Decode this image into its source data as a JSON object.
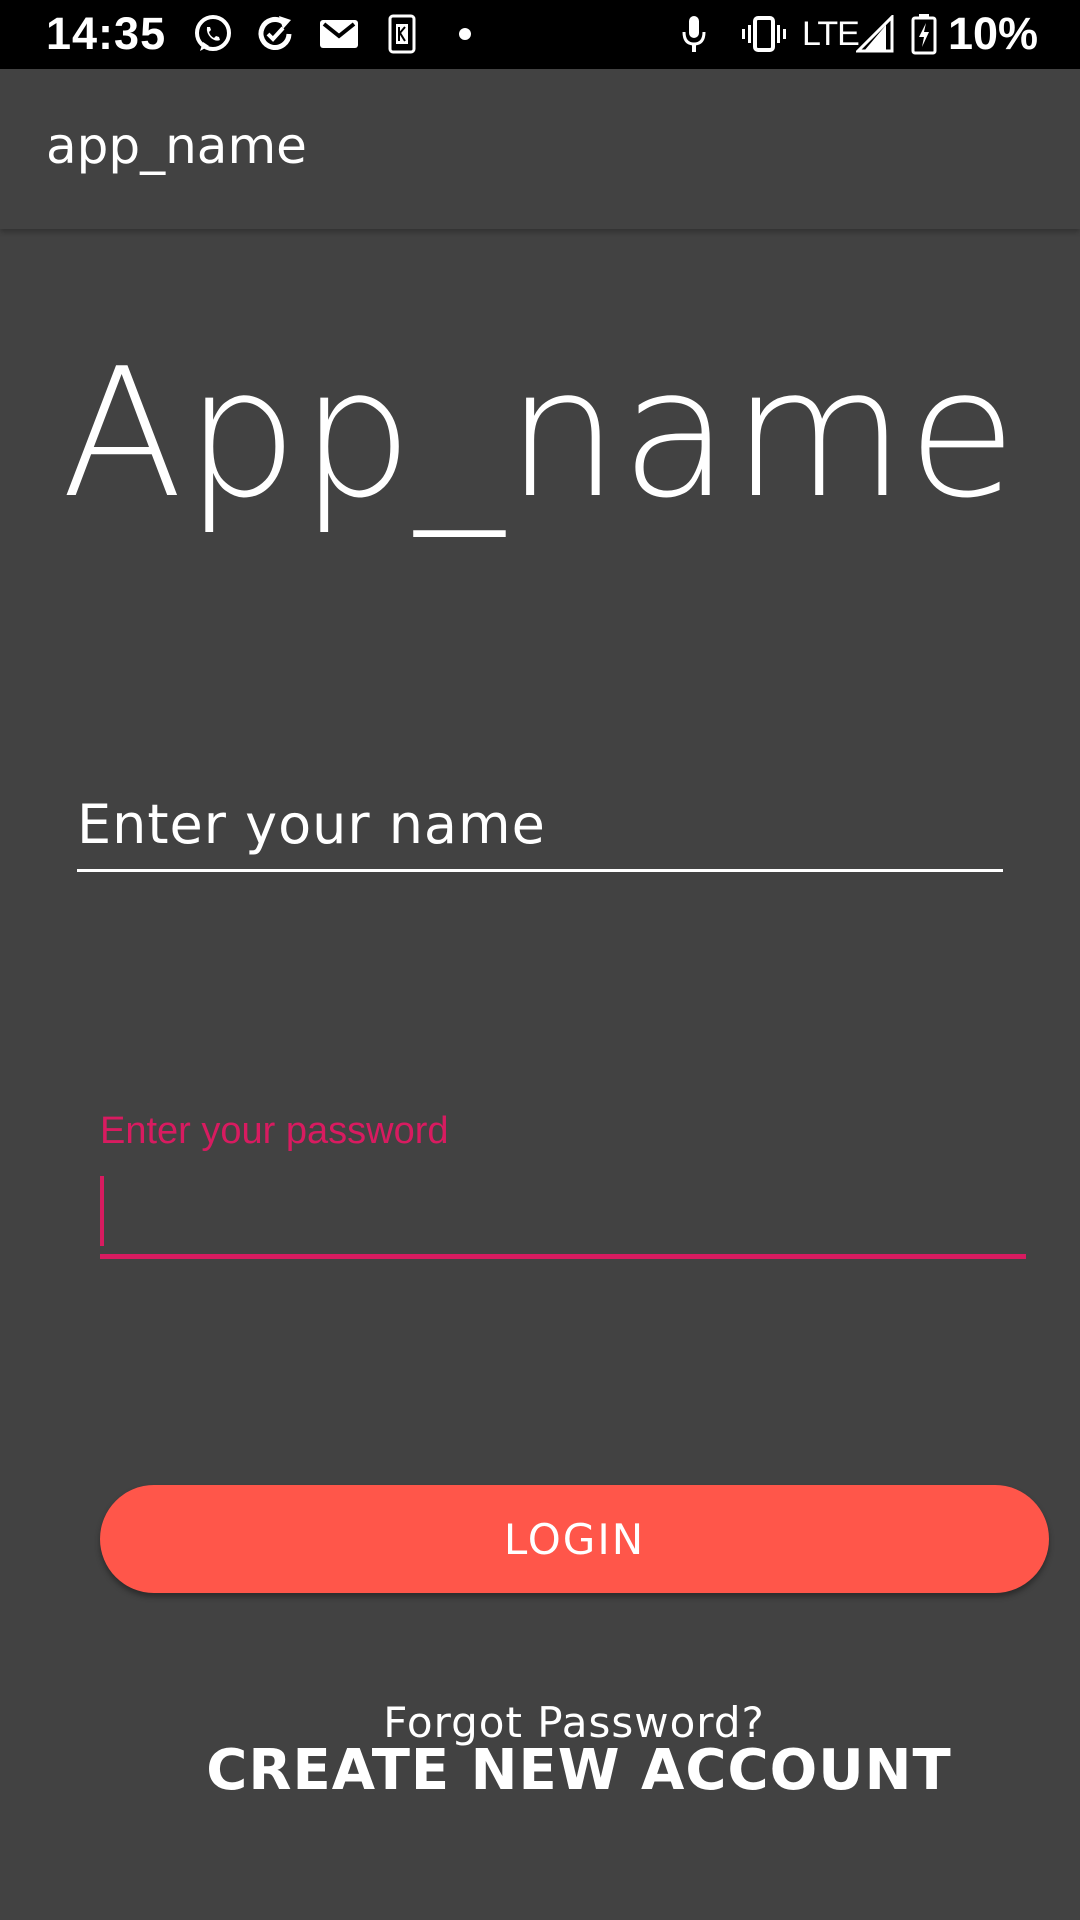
{
  "status_bar": {
    "time": "14:35",
    "network": "LTE",
    "battery": "10%",
    "icons": [
      "whatsapp-icon",
      "sync-icon",
      "gmail-icon",
      "sim-app-icon",
      "notification-dot-icon",
      "mic-icon",
      "vibrate-icon",
      "signal-icon",
      "battery-charging-icon"
    ]
  },
  "app_bar": {
    "title": "app_name"
  },
  "main": {
    "logo_title": "App_name",
    "name_field": {
      "placeholder": "Enter your name",
      "value": ""
    },
    "password_field": {
      "label": "Enter your password",
      "value": ""
    },
    "login_label": "LOGIN",
    "forgot_label": "Forgot Password?",
    "create_account_label": "CREATE NEW ACCOUNT"
  },
  "colors": {
    "background": "#424242",
    "accent": "#d81b60",
    "button": "#ff564a"
  }
}
